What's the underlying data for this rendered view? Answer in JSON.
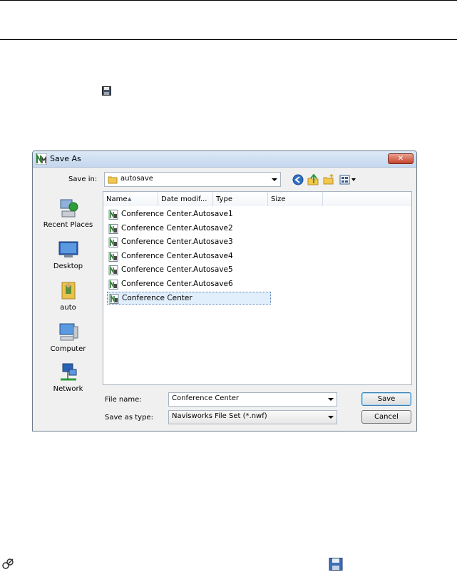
{
  "dialog": {
    "title": "Save As",
    "close_glyph": "✕",
    "save_in_label": "Save in:",
    "save_in_value": "autosave",
    "places": [
      {
        "label": "Recent Places",
        "icon": "recent-places-icon"
      },
      {
        "label": "Desktop",
        "icon": "desktop-icon"
      },
      {
        "label": "auto",
        "icon": "user-folder-icon"
      },
      {
        "label": "Computer",
        "icon": "computer-icon"
      },
      {
        "label": "Network",
        "icon": "network-icon"
      }
    ],
    "columns": [
      "Name",
      "Date modif...",
      "Type",
      "Size"
    ],
    "files": [
      "Conference Center.Autosave1",
      "Conference Center.Autosave2",
      "Conference Center.Autosave3",
      "Conference Center.Autosave4",
      "Conference Center.Autosave5",
      "Conference Center.Autosave6",
      "Conference Center"
    ],
    "selected_index": 6,
    "file_name_label": "File name:",
    "file_name_value": "Conference Center",
    "save_type_label": "Save as type:",
    "save_type_value": "Navisworks File Set (*.nwf)",
    "save_button": "Save",
    "cancel_button": "Cancel"
  },
  "colors": {
    "accent": "#3c7fb1",
    "close": "#c6442c",
    "selection": "#e1eefc"
  }
}
